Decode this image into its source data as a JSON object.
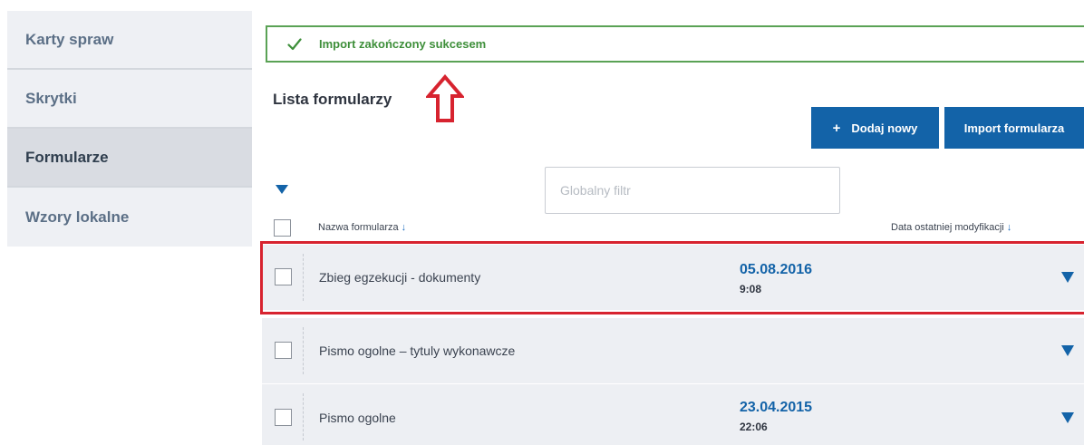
{
  "sidebar": {
    "items": [
      {
        "label": "Karty spraw",
        "active": false
      },
      {
        "label": "Skrytki",
        "active": false
      },
      {
        "label": "Formularze",
        "active": true
      },
      {
        "label": "Wzory lokalne",
        "active": false
      }
    ]
  },
  "banner": {
    "message": "Import zakończony sukcesem",
    "icon": "check-icon",
    "color": "#3e8f3a"
  },
  "page": {
    "title": "Lista formularzy"
  },
  "toolbar": {
    "add_icon": "+",
    "add_label": "Dodaj nowy",
    "import_label": "Import formularza",
    "accent": "#1363a8"
  },
  "filter": {
    "placeholder": "Globalny filtr",
    "value": ""
  },
  "table": {
    "columns": [
      {
        "label": "Nazwa formularza",
        "sort_arrow": "↓"
      },
      {
        "label": "Data ostatniej modyfikacji",
        "sort_arrow": "↓"
      }
    ],
    "rows": [
      {
        "name": "Zbieg egzekucji - dokumenty",
        "date": "05.08.2016",
        "time": "9:08",
        "highlighted": true
      },
      {
        "name": "Pismo ogolne – tytuly wykonawcze",
        "date": "",
        "time": "",
        "highlighted": false
      },
      {
        "name": "Pismo ogolne",
        "date": "23.04.2015",
        "time": "22:06",
        "highlighted": false
      }
    ]
  },
  "annotations": {
    "highlight_color": "#d7232f"
  }
}
